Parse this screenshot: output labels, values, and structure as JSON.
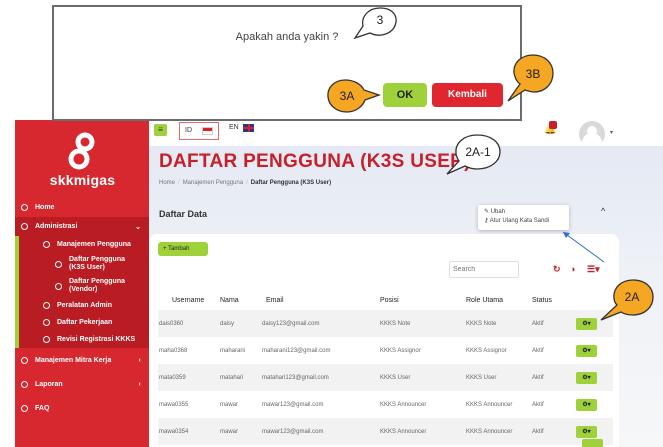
{
  "sidebar": {
    "brand": "skkmigas",
    "items": [
      {
        "label": "Home"
      },
      {
        "label": "Administrasi"
      },
      {
        "label": "Manajemen Pengguna"
      },
      {
        "label": "Daftar Pengguna (K3S User)"
      },
      {
        "label": "Daftar Pengguna (Vendor)"
      },
      {
        "label": "Peralatan Admin"
      },
      {
        "label": "Daftar Pekerjaan"
      },
      {
        "label": "Revisi Registrasi KKKS"
      },
      {
        "label": "Manajemen Mitra Kerja"
      },
      {
        "label": "Laporan"
      },
      {
        "label": "FAQ"
      }
    ]
  },
  "topbar": {
    "lang_id": "ID",
    "lang_en": "EN"
  },
  "page": {
    "title": "DAFTAR PENGGUNA (K3S USER)",
    "breadcrumb": [
      "Home",
      "Manajemen Pengguna",
      "Daftar Pengguna (K3S User)"
    ],
    "section": "Daftar Data"
  },
  "dropdown": {
    "ubah": "Ubah",
    "atur": "Atur Ulang Kata Sandi"
  },
  "toolbar": {
    "tambah": "Tambah",
    "search_placeholder": "Search"
  },
  "table": {
    "headers": [
      "Username",
      "Nama",
      "Email",
      "Posisi",
      "Role Utama",
      "Status"
    ],
    "rows": [
      [
        "dais0360",
        "daisy",
        "daisy123@gmail.com",
        "KKKS Note",
        "KKKS Note",
        "Aktif"
      ],
      [
        "maha0368",
        "maharani",
        "maharani123@gmail.com",
        "KKKS Assignor",
        "KKKS Assignor",
        "Aktif"
      ],
      [
        "mata0359",
        "matahari",
        "matahari123@gmail.com",
        "KKKS User",
        "KKKS User",
        "Aktif"
      ],
      [
        "mawa0355",
        "mawar",
        "mawar123@gmail.com",
        "KKKS Announcer",
        "KKKS Announcer",
        "Aktif"
      ],
      [
        "mawa0354",
        "mawar",
        "mawar123@gmail.com",
        "KKKS Announcer",
        "KKKS Announcer",
        "Aktif"
      ]
    ]
  },
  "dialog": {
    "message": "Apakah anda yakin ?",
    "ok": "OK",
    "kembali": "Kembali"
  },
  "callouts": {
    "c3": "3",
    "c3a": "3A",
    "c3b": "3B",
    "c2a1": "2A-1",
    "c2a": "2A"
  },
  "colors": {
    "brand_red": "#d7282f",
    "accent_green": "#9fd13a",
    "callout_orange": "#f5a623"
  }
}
